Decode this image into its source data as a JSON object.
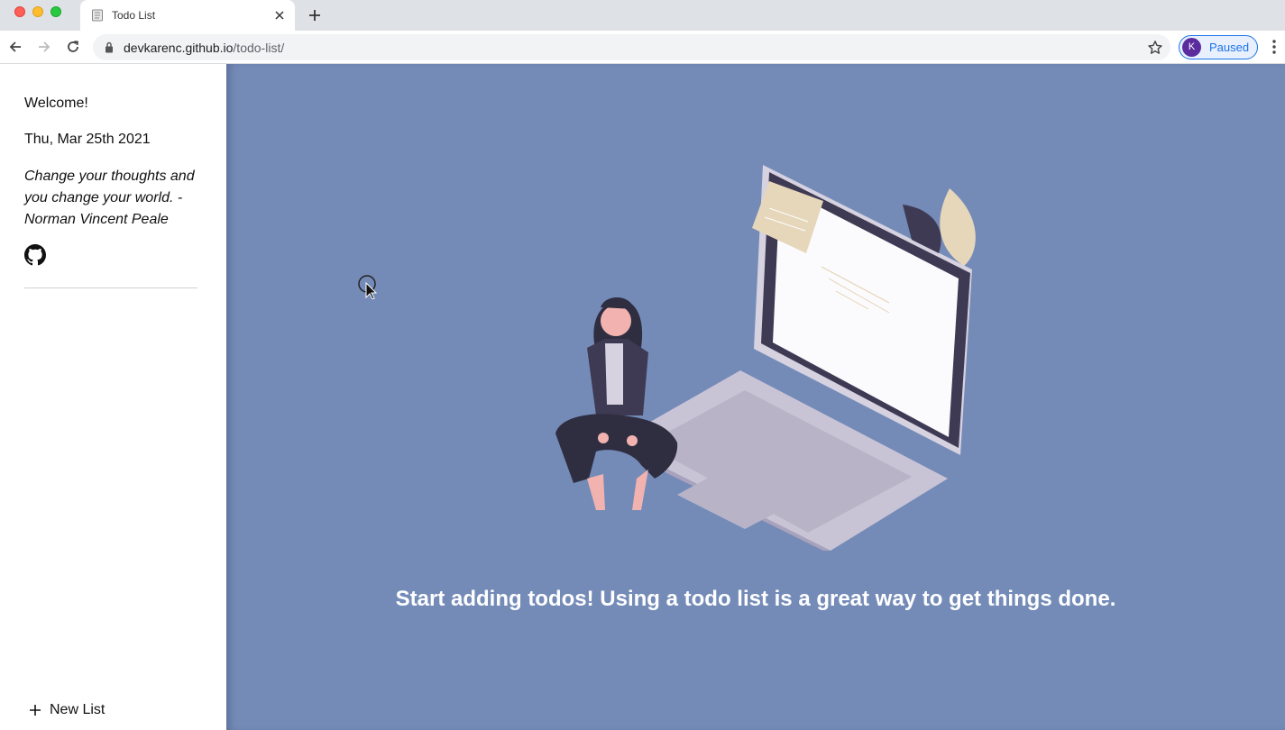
{
  "browser": {
    "tab_title": "Todo List",
    "url_host": "devkarenc.github.io",
    "url_path": "/todo-list/",
    "profile_initial": "K",
    "profile_status": "Paused"
  },
  "sidebar": {
    "welcome": "Welcome!",
    "date": "Thu, Mar 25th 2021",
    "quote": "Change your thoughts and you change your world. - Norman Vincent Peale",
    "new_list_label": "New List"
  },
  "main": {
    "empty_message": "Start adding todos! Using a todo list is a great way to get things done.",
    "background_color": "#748bb8"
  }
}
